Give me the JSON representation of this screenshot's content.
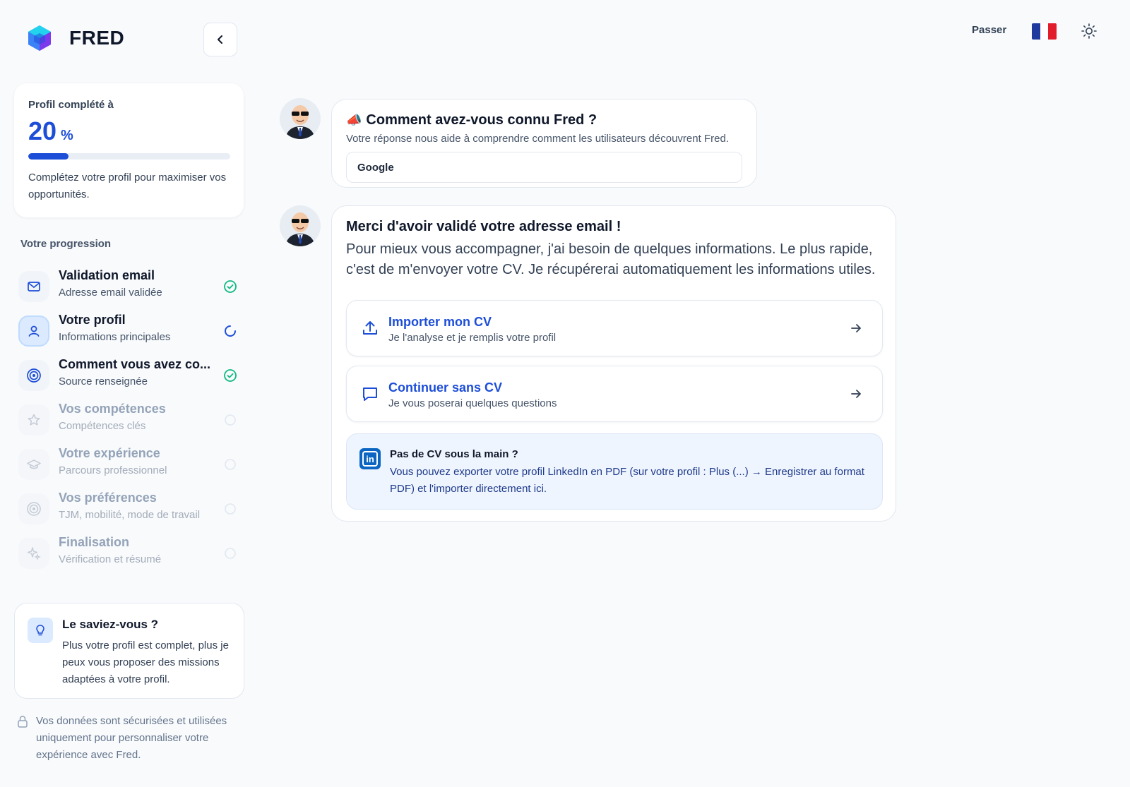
{
  "brand": {
    "name": "FRED"
  },
  "topbar": {
    "skip_label": "Passer",
    "flag_colors": [
      "#1e3a9f",
      "#ffffff",
      "#e11d2b"
    ]
  },
  "profile": {
    "title": "Profil complété à",
    "percent": "20",
    "percent_unit": "%",
    "progress_fraction": 0.2,
    "description": "Complétez votre profil pour maximiser vos opportunités."
  },
  "progression": {
    "title": "Votre progression",
    "steps": [
      {
        "title": "Validation email",
        "subtitle": "Adresse email validée",
        "icon": "mail-icon",
        "status": "done"
      },
      {
        "title": "Votre profil",
        "subtitle": "Informations principales",
        "icon": "user-icon",
        "status": "in-progress"
      },
      {
        "title": "Comment vous avez co...",
        "subtitle": "Source renseignée",
        "icon": "target-icon",
        "status": "done"
      },
      {
        "title": "Vos compétences",
        "subtitle": "Compétences clés",
        "icon": "star-icon",
        "status": "pending"
      },
      {
        "title": "Votre expérience",
        "subtitle": "Parcours professionnel",
        "icon": "graduation-cap-icon",
        "status": "pending"
      },
      {
        "title": "Vos préférences",
        "subtitle": "TJM, mobilité, mode de travail",
        "icon": "target-icon",
        "status": "pending"
      },
      {
        "title": "Finalisation",
        "subtitle": "Vérification et résumé",
        "icon": "sparkles-icon",
        "status": "pending"
      }
    ]
  },
  "tip": {
    "title": "Le saviez-vous ?",
    "text": "Plus votre profil est complet, plus je peux vous proposer des missions adaptées à votre profil."
  },
  "privacy": {
    "text": "Vos données sont sécurisées et utilisées uniquement pour personnaliser votre expérience avec Fred."
  },
  "chat": {
    "question": {
      "emoji": "📣",
      "title": "Comment avez-vous connu Fred ?",
      "subtitle": "Votre réponse nous aide à comprendre comment les utilisateurs découvrent Fred.",
      "answer": "Google"
    },
    "message": {
      "title": "Merci d'avoir validé votre adresse email !",
      "text": "Pour mieux vous accompagner, j'ai besoin de quelques informations. Le plus rapide, c'est de m'envoyer votre CV. Je récupérerai automatiquement les informations utiles.",
      "actions": [
        {
          "title": "Importer mon CV",
          "subtitle": "Je l'analyse et je remplis votre profil",
          "icon": "upload-icon"
        },
        {
          "title": "Continuer sans CV",
          "subtitle": "Je vous poserai quelques questions",
          "icon": "message-icon"
        }
      ],
      "linkedin": {
        "title": "Pas de CV sous la main ?",
        "text": "Vous pouvez exporter votre profil LinkedIn en PDF (sur votre profil : Plus (...) → Enregistrer au format PDF) et l'importer directement ici."
      }
    }
  },
  "colors": {
    "accent": "#1d4ed8",
    "success": "#10b981",
    "linkedin": "#0a66c2"
  }
}
